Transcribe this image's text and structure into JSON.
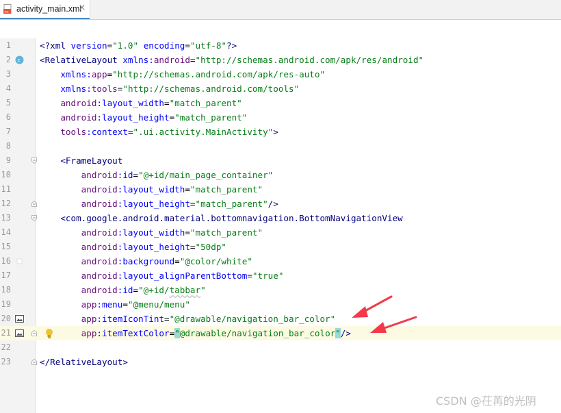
{
  "tab": {
    "label": "activity_main.xml",
    "close_glyph": "×"
  },
  "lines": [
    {
      "n": "1",
      "segs": [
        [
          "pi",
          "<?"
        ],
        [
          "tag",
          "xml "
        ],
        [
          "attr",
          "version"
        ],
        [
          "plain",
          "="
        ],
        [
          "val",
          "\"1.0\""
        ],
        [
          "plain",
          " "
        ],
        [
          "attr",
          "encoding"
        ],
        [
          "plain",
          "="
        ],
        [
          "val",
          "\"utf-8\""
        ],
        [
          "pi",
          "?>"
        ]
      ]
    },
    {
      "n": "2",
      "marker": "class-icon",
      "segs": [
        [
          "tag",
          "<RelativeLayout "
        ],
        [
          "attr",
          "xmlns:"
        ],
        [
          "ns",
          "android"
        ],
        [
          "plain",
          "="
        ],
        [
          "val",
          "\"http://schemas.android.com/apk/res/android\""
        ]
      ]
    },
    {
      "n": "3",
      "segs": [
        [
          "plain",
          "    "
        ],
        [
          "attr",
          "xmlns:"
        ],
        [
          "ns",
          "app"
        ],
        [
          "plain",
          "="
        ],
        [
          "val",
          "\"http://schemas.android.com/apk/res-auto\""
        ]
      ]
    },
    {
      "n": "4",
      "segs": [
        [
          "plain",
          "    "
        ],
        [
          "attr",
          "xmlns:"
        ],
        [
          "ns",
          "tools"
        ],
        [
          "plain",
          "="
        ],
        [
          "val",
          "\"http://schemas.android.com/tools\""
        ]
      ]
    },
    {
      "n": "5",
      "segs": [
        [
          "plain",
          "    "
        ],
        [
          "ns",
          "android"
        ],
        [
          "attr",
          ":layout_width"
        ],
        [
          "plain",
          "="
        ],
        [
          "val",
          "\"match_parent\""
        ]
      ]
    },
    {
      "n": "6",
      "segs": [
        [
          "plain",
          "    "
        ],
        [
          "ns",
          "android"
        ],
        [
          "attr",
          ":layout_height"
        ],
        [
          "plain",
          "="
        ],
        [
          "val",
          "\"match_parent\""
        ]
      ]
    },
    {
      "n": "7",
      "segs": [
        [
          "plain",
          "    "
        ],
        [
          "ns",
          "tools"
        ],
        [
          "attr",
          ":context"
        ],
        [
          "plain",
          "="
        ],
        [
          "val",
          "\".ui.activity.MainActivity\""
        ],
        [
          "tag",
          ">"
        ]
      ]
    },
    {
      "n": "8",
      "segs": []
    },
    {
      "n": "9",
      "fold": "open",
      "segs": [
        [
          "plain",
          "    "
        ],
        [
          "tag",
          "<FrameLayout"
        ]
      ]
    },
    {
      "n": "10",
      "segs": [
        [
          "plain",
          "        "
        ],
        [
          "ns",
          "android"
        ],
        [
          "attr",
          ":id"
        ],
        [
          "plain",
          "="
        ],
        [
          "val",
          "\"@+id/main_page_container\""
        ]
      ]
    },
    {
      "n": "11",
      "segs": [
        [
          "plain",
          "        "
        ],
        [
          "ns",
          "android"
        ],
        [
          "attr",
          ":layout_width"
        ],
        [
          "plain",
          "="
        ],
        [
          "val",
          "\"match_parent\""
        ]
      ]
    },
    {
      "n": "12",
      "fold": "close",
      "segs": [
        [
          "plain",
          "        "
        ],
        [
          "ns",
          "android"
        ],
        [
          "attr",
          ":layout_height"
        ],
        [
          "plain",
          "="
        ],
        [
          "val",
          "\"match_parent\""
        ],
        [
          "tag",
          "/>"
        ]
      ]
    },
    {
      "n": "13",
      "fold": "open",
      "segs": [
        [
          "plain",
          "    "
        ],
        [
          "tag",
          "<com.google.android.material.bottomnavigation.BottomNavigationView"
        ]
      ]
    },
    {
      "n": "14",
      "segs": [
        [
          "plain",
          "        "
        ],
        [
          "ns",
          "android"
        ],
        [
          "attr",
          ":layout_width"
        ],
        [
          "plain",
          "="
        ],
        [
          "val",
          "\"match_parent\""
        ]
      ]
    },
    {
      "n": "15",
      "segs": [
        [
          "plain",
          "        "
        ],
        [
          "ns",
          "android"
        ],
        [
          "attr",
          ":layout_height"
        ],
        [
          "plain",
          "="
        ],
        [
          "val",
          "\"50dp\""
        ]
      ]
    },
    {
      "n": "16",
      "marker": "white-swatch",
      "segs": [
        [
          "plain",
          "        "
        ],
        [
          "ns",
          "android"
        ],
        [
          "attr",
          ":background"
        ],
        [
          "plain",
          "="
        ],
        [
          "val",
          "\"@color/white\""
        ]
      ]
    },
    {
      "n": "17",
      "segs": [
        [
          "plain",
          "        "
        ],
        [
          "ns",
          "android"
        ],
        [
          "attr",
          ":layout_alignParentBottom"
        ],
        [
          "plain",
          "="
        ],
        [
          "val",
          "\"true\""
        ]
      ]
    },
    {
      "n": "18",
      "segs": [
        [
          "plain",
          "        "
        ],
        [
          "ns",
          "android"
        ],
        [
          "attr",
          ":id"
        ],
        [
          "plain",
          "="
        ],
        [
          "val",
          "\"@+id/"
        ],
        [
          "valsq",
          "tabbar"
        ],
        [
          "val",
          "\""
        ]
      ]
    },
    {
      "n": "19",
      "segs": [
        [
          "plain",
          "        "
        ],
        [
          "ns",
          "app"
        ],
        [
          "attr",
          ":menu"
        ],
        [
          "plain",
          "="
        ],
        [
          "val",
          "\"@menu/menu\""
        ]
      ]
    },
    {
      "n": "20",
      "marker": "image-icon",
      "segs": [
        [
          "plain",
          "        "
        ],
        [
          "ns",
          "app"
        ],
        [
          "attr",
          ":itemIconTint"
        ],
        [
          "plain",
          "="
        ],
        [
          "val",
          "\"@drawable/navigation_bar_color\""
        ]
      ]
    },
    {
      "n": "21",
      "marker": "image-icon",
      "current": true,
      "bulb": true,
      "fold": "close",
      "segs": [
        [
          "plain",
          "        "
        ],
        [
          "ns",
          "app"
        ],
        [
          "attr",
          ":itemTextColor"
        ],
        [
          "plain",
          "="
        ],
        [
          "hl",
          "\""
        ],
        [
          "val",
          "@drawable/navigation_bar_color"
        ],
        [
          "hl",
          "\""
        ],
        [
          "tag",
          "/>"
        ]
      ]
    },
    {
      "n": "22",
      "segs": []
    },
    {
      "n": "23",
      "fold": "close",
      "segs": [
        [
          "tag",
          "</RelativeLayout>"
        ]
      ]
    }
  ],
  "colors": {
    "tag": "#000080",
    "attr": "#0000ff",
    "ns": "#660e7a",
    "value": "#067d17",
    "arrow": "#f23a4a",
    "current_line": "#fcfae3",
    "bracket_highlight": "#99d9dc"
  },
  "watermark": {
    "text": "CSDN @茌苒的光阴"
  }
}
